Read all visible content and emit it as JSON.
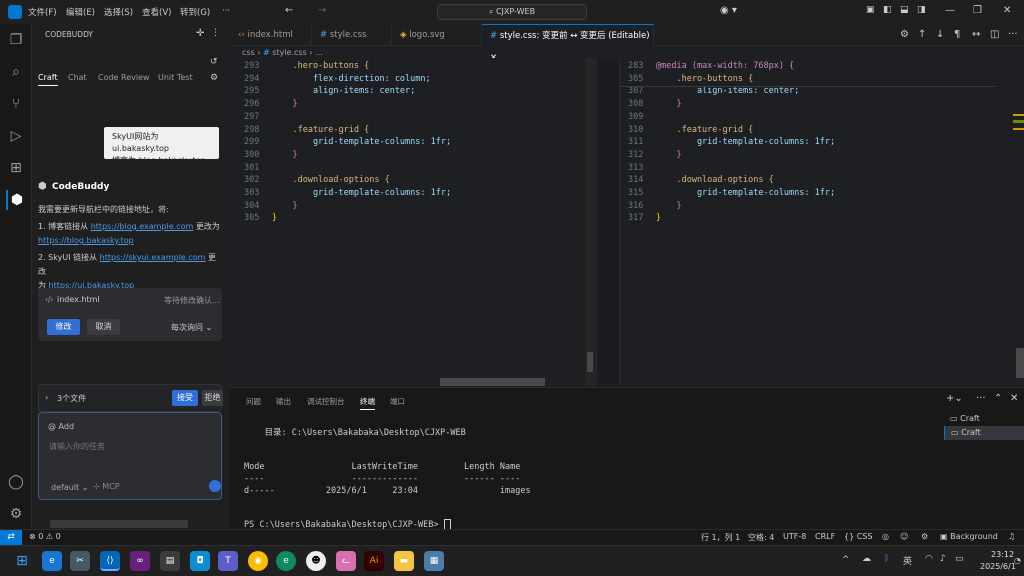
{
  "titlebar": {
    "menus": [
      "文件(F)",
      "编辑(E)",
      "选择(S)",
      "查看(V)",
      "转到(G)"
    ],
    "more": "···",
    "search": "CJXP-WEB"
  },
  "side": {
    "header": "CODEBUDDY",
    "tabs": [
      "Craft",
      "Chat",
      "Code Review",
      "Unit Test"
    ],
    "chip_lines": [
      "SkyUI网站为 ui.bakasky.top",
      "博客为:blog.bakasky.top"
    ],
    "assistant": "CodeBuddy",
    "msg_intro": "我需要更新导航栏中的链接地址，将:",
    "msg1_prefix": "1. 博客链接从 ",
    "msg1_link1": "https://blog.example.com",
    "msg1_mid": " 更改为",
    "msg1_link2": "https://blog.bakasky.top",
    "msg2_prefix": "2. SkyUI 链接从 ",
    "msg2_link1": "https://skyui.example.com",
    "msg2_mid": " 更改",
    "msg2_prefix2": "为 ",
    "msg2_link2": "https://ui.bakasky.top",
    "confirm_file": "index.html",
    "confirm_status": "等待修改确认...",
    "edit_btn": "修改",
    "cancel_btn": "取消",
    "ask_mode": "每次询问",
    "files_count": "3个文件",
    "accept_btn": "接受",
    "reject_btn": "拒绝",
    "add_label": "@ Add",
    "input_placeholder": "请输入你的任务",
    "model": "default",
    "mcp": "MCP"
  },
  "editor_tabs": [
    "index.html",
    "style.css",
    "logo.svg",
    "style.css: 变更前 ↔ 变更后 (Editable)"
  ],
  "breadcrumb": [
    "css",
    "style.css",
    "..."
  ],
  "left_code": [
    {
      "n": "293",
      "t": "    .hero-buttons {",
      "c": "sel"
    },
    {
      "n": "294",
      "t": "        flex-direction: column;",
      "c": "prop"
    },
    {
      "n": "295",
      "t": "        align-items: center;",
      "c": "prop"
    },
    {
      "n": "296",
      "t": "    }",
      "c": "br"
    },
    {
      "n": "297",
      "t": "",
      "c": "code"
    },
    {
      "n": "298",
      "t": "    .feature-grid {",
      "c": "sel"
    },
    {
      "n": "299",
      "t": "        grid-template-columns: 1fr;",
      "c": "prop"
    },
    {
      "n": "300",
      "t": "    }",
      "c": "br"
    },
    {
      "n": "301",
      "t": "",
      "c": "code"
    },
    {
      "n": "302",
      "t": "    .download-options {",
      "c": "sel"
    },
    {
      "n": "303",
      "t": "        grid-template-columns: 1fr;",
      "c": "prop"
    },
    {
      "n": "304",
      "t": "    }",
      "c": "br"
    },
    {
      "n": "305",
      "t": "}",
      "c": "br2"
    }
  ],
  "right_code": [
    {
      "n": "283",
      "t": "@media (max-width: 768px) {",
      "c": "kw"
    },
    {
      "n": "305",
      "t": "    .hero-buttons {",
      "c": "sel"
    },
    {
      "n": "307",
      "t": "        align-items: center;",
      "c": "prop"
    },
    {
      "n": "308",
      "t": "    }",
      "c": "br"
    },
    {
      "n": "309",
      "t": "",
      "c": "code"
    },
    {
      "n": "310",
      "t": "    .feature-grid {",
      "c": "sel"
    },
    {
      "n": "311",
      "t": "        grid-template-columns: 1fr;",
      "c": "prop"
    },
    {
      "n": "312",
      "t": "    }",
      "c": "br"
    },
    {
      "n": "313",
      "t": "",
      "c": "code"
    },
    {
      "n": "314",
      "t": "    .download-options {",
      "c": "sel"
    },
    {
      "n": "315",
      "t": "        grid-template-columns: 1fr;",
      "c": "prop"
    },
    {
      "n": "316",
      "t": "    }",
      "c": "br"
    },
    {
      "n": "317",
      "t": "}",
      "c": "br2"
    }
  ],
  "panel_tabs": [
    "问题",
    "输出",
    "调试控制台",
    "终端",
    "端口"
  ],
  "terminal": {
    "dir_line": "    目录: C:\\Users\\Bakabaka\\Desktop\\CJXP-WEB",
    "header": "Mode                 LastWriteTime         Length Name",
    "dashes": "----                 -------------         ------ ----",
    "row": "d-----          2025/6/1     23:04                images",
    "prompt": "PS C:\\Users\\Bakabaka\\Desktop\\CJXP-WEB> "
  },
  "term_list": [
    "Craft",
    "Craft"
  ],
  "status": {
    "errors": "⊗ 0 ⚠ 0",
    "position": "行 1，列 1",
    "spaces": "空格: 4",
    "encoding": "UTF-8",
    "eol": "CRLF",
    "lang": "{} CSS",
    "bg": "Background"
  },
  "taskbar": {
    "ime": "英",
    "time": "23:12",
    "date": "2025/6/1"
  }
}
